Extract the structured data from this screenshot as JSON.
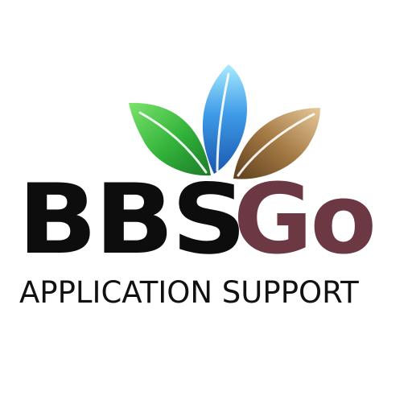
{
  "logo": {
    "word_dark": "BBS",
    "word_accent": "Go",
    "tagline": "APPLICATION SUPPORT",
    "colors": {
      "dark_text": "#0d0d0d",
      "accent_text": "#6b3843",
      "leaf_left": "#3fbf3f",
      "leaf_center": "#3c8fe0",
      "leaf_right": "#8a6530",
      "background": "#ffffff"
    },
    "icon": "three-leaves-icon"
  }
}
